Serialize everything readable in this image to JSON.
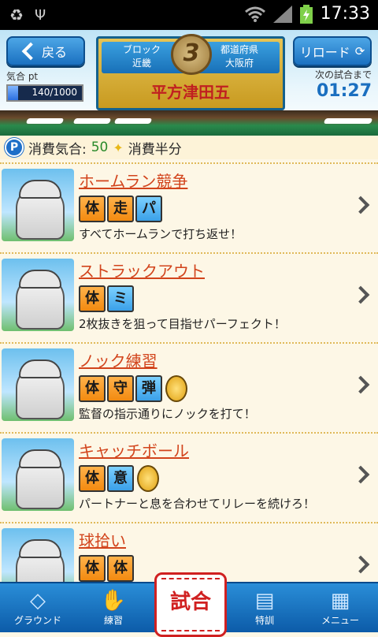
{
  "status_bar": {
    "time": "17:33",
    "icons": [
      "recycle-icon",
      "usb-icon",
      "wifi-icon",
      "signal-icon",
      "battery-charging-icon"
    ]
  },
  "header": {
    "back_label": "戻る",
    "reload_label": "リロード",
    "stamina_label": "気合 pt",
    "stamina_value": "140/1000",
    "stamina_fraction": 0.14,
    "block_label": "ブロック",
    "block_value": "近畿",
    "pref_label": "都道府県",
    "pref_value": "大阪府",
    "team_name": "平方津田五",
    "rank_emblem": "3",
    "next_game_label": "次の試合まで",
    "next_game_time": "01:27"
  },
  "cost": {
    "label": "消費気合:",
    "value": "50",
    "half_label": "消費半分"
  },
  "items": [
    {
      "title": "ホームラン競争",
      "tags": [
        {
          "t": "体",
          "c": "orange"
        },
        {
          "t": "走",
          "c": "orange"
        },
        {
          "t": "パ",
          "c": "blue"
        }
      ],
      "coin": false,
      "desc": "すべてホームランで打ち返せ！"
    },
    {
      "title": "ストラックアウト",
      "tags": [
        {
          "t": "体",
          "c": "orange"
        },
        {
          "t": "ミ",
          "c": "blue"
        }
      ],
      "coin": false,
      "desc": "2枚抜きを狙って目指せパーフェクト！"
    },
    {
      "title": "ノック練習",
      "tags": [
        {
          "t": "体",
          "c": "orange"
        },
        {
          "t": "守",
          "c": "orange"
        },
        {
          "t": "弾",
          "c": "blue"
        }
      ],
      "coin": true,
      "desc": "監督の指示通りにノックを打て！"
    },
    {
      "title": "キャッチボール",
      "tags": [
        {
          "t": "体",
          "c": "orange"
        },
        {
          "t": "意",
          "c": "blue"
        }
      ],
      "coin": true,
      "desc": "パートナーと息を合わせてリレーを続けろ！"
    },
    {
      "title": "球拾い",
      "tags": [
        {
          "t": "体",
          "c": "orange"
        },
        {
          "t": "体",
          "c": "orange"
        }
      ],
      "coin": false,
      "desc": ""
    }
  ],
  "bottom_nav": {
    "ground": "グラウンド",
    "practice": "練習",
    "battle": "試合",
    "training": "特訓",
    "menu": "メニュー"
  }
}
